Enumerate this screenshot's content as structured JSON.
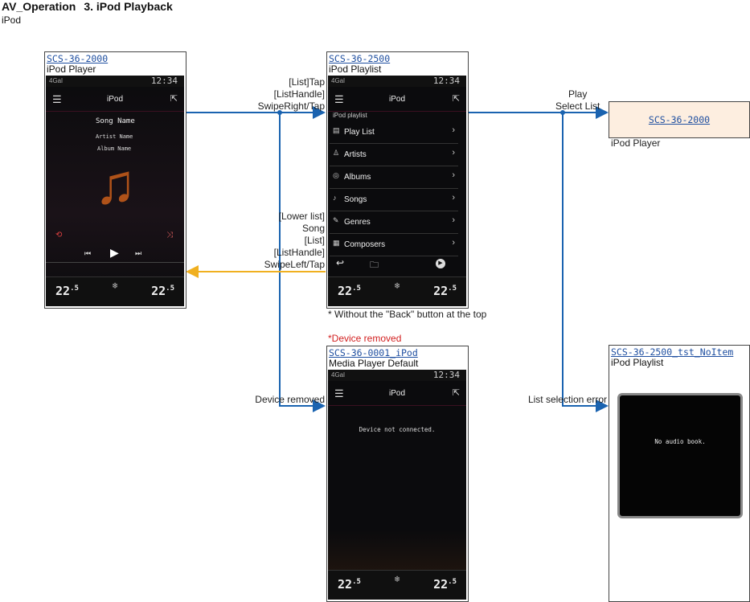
{
  "header": {
    "section": "AV_Operation",
    "title": "3. iPod Playback",
    "subtitle": "iPod"
  },
  "screens": {
    "player": {
      "id": "SCS-36-2000",
      "name": "iPod Player",
      "status_left": "4Gal",
      "clock": "12:34",
      "top_title": "iPod",
      "song": "Song Name",
      "artist": "Artist Name",
      "album": "Album Name",
      "temp_left": "22",
      "temp_right": "22",
      "temp_decimal": ".5"
    },
    "playlist": {
      "id": "SCS-36-2500",
      "name": "iPod Playlist",
      "status_left": "4Gal",
      "clock": "12:34",
      "top_title": "iPod",
      "list_header": "iPod playlist",
      "items": [
        "Play List",
        "Artists",
        "Albums",
        "Songs",
        "Genres",
        "Composers"
      ],
      "temp_left": "22",
      "temp_right": "22",
      "temp_decimal": ".5",
      "note": "* Without the \"Back\" button at the top"
    },
    "player_ref": {
      "id": "SCS-36-2000",
      "name": "iPod Player"
    },
    "default": {
      "id": "SCS-36-0001_iPod",
      "name": "Media Player Default",
      "status_left": "4Gal",
      "clock": "12:34",
      "top_title": "iPod",
      "message": "Device not connected.",
      "temp_left": "22",
      "temp_right": "22",
      "temp_decimal": ".5",
      "caption": "*Device removed"
    },
    "noitem": {
      "id": "SCS-36-2500_tst_NoItem",
      "name": "iPod Playlist",
      "message": "No audio book."
    }
  },
  "transitions": {
    "to_playlist": [
      "[List]Tap",
      "[ListHandle]",
      "SwipeRight/Tap"
    ],
    "to_player": [
      "Play",
      "Select List"
    ],
    "back_to_player": [
      "[Lower list]",
      "Song",
      "[List]",
      "[ListHandle]",
      "SwipeLeft/Tap"
    ],
    "device_removed": "Device removed",
    "list_error": "List selection error"
  },
  "colors": {
    "blue_arrow": "#1a63b0",
    "orange_arrow": "#f0b020",
    "ref_fill": "#fdeee0",
    "red_text": "#d22020"
  }
}
